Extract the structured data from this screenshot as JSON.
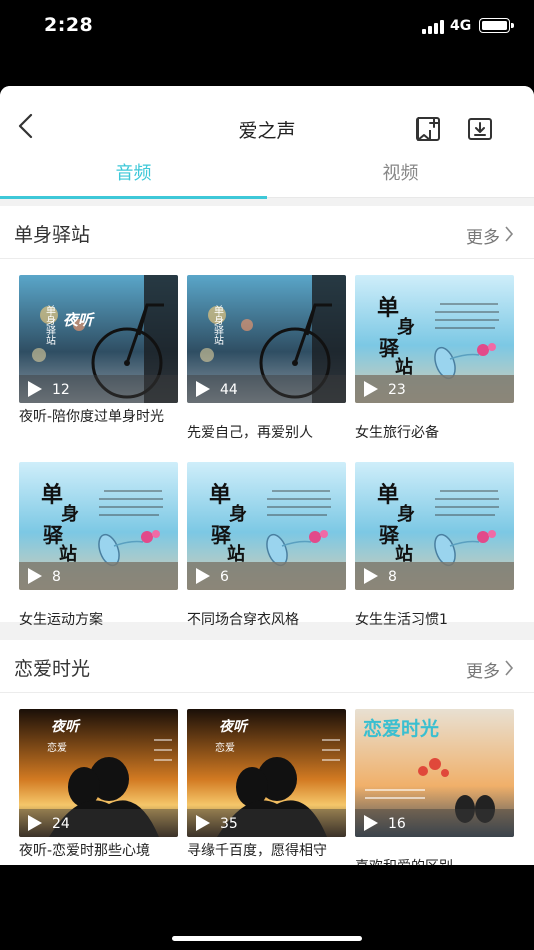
{
  "status_bar": {
    "time": "2:28",
    "network": "4G"
  },
  "nav": {
    "title": "爱之声"
  },
  "tabs": [
    {
      "label": "音频",
      "active": true
    },
    {
      "label": "视频",
      "active": false
    }
  ],
  "sections": [
    {
      "title": "单身驿站",
      "more_label": "更多",
      "items": [
        {
          "title": "夜听-陪你度过单身时光",
          "count": "12",
          "thumb": "bicycle-night"
        },
        {
          "title": "先爱自己，再爱别人",
          "count": "44",
          "thumb": "bicycle"
        },
        {
          "title": "女生旅行必备",
          "count": "23",
          "thumb": "bottle-beach"
        },
        {
          "title": "女生运动方案",
          "count": "8",
          "thumb": "bottle-beach"
        },
        {
          "title": "不同场合穿衣风格",
          "count": "6",
          "thumb": "bottle-beach"
        },
        {
          "title": "女生生活习惯1",
          "count": "8",
          "thumb": "bottle-beach"
        }
      ]
    },
    {
      "title": "恋爱时光",
      "more_label": "更多",
      "items": [
        {
          "title": "夜听-恋爱时那些心境",
          "count": "24",
          "thumb": "sunset-couple"
        },
        {
          "title": "寻缘千百度，愿得相守",
          "count": "35",
          "thumb": "sunset-couple"
        },
        {
          "title": "喜欢和爱的区别",
          "count": "16",
          "thumb": "love-time"
        }
      ]
    }
  ],
  "thumb_text": {
    "night_listen": "夜听",
    "single_station": "单身驿站",
    "love": "恋爱",
    "love_time": "恋爱时光"
  },
  "colors": {
    "accent": "#3ec8d8",
    "background": "#f2f2f2",
    "status_bar": "#000000"
  },
  "icons": [
    "back-chevron-icon",
    "add-bookmark-icon",
    "download-icon",
    "more-chevron-icon",
    "play-icon"
  ]
}
